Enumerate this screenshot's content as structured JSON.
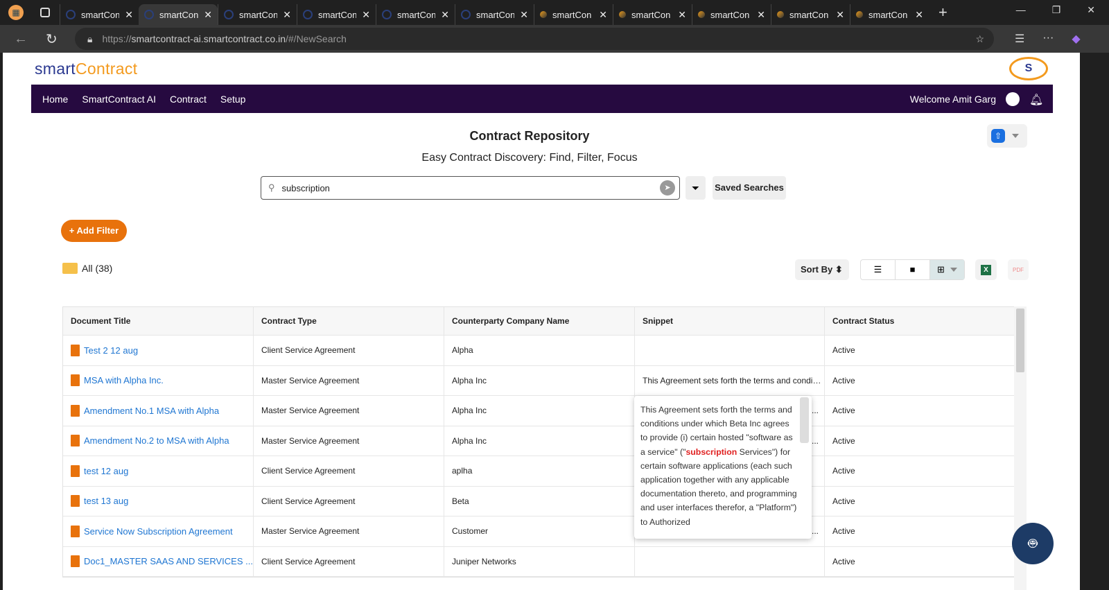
{
  "browser": {
    "tabs": [
      {
        "label": "smartCon"
      },
      {
        "label": "smartCon",
        "active": true
      },
      {
        "label": "smartCon"
      },
      {
        "label": "smartCon"
      },
      {
        "label": "smartCon"
      },
      {
        "label": "smartCon"
      },
      {
        "label": "smartCon"
      },
      {
        "label": "smartCon"
      },
      {
        "label": "smartCon"
      },
      {
        "label": "smartCon"
      },
      {
        "label": "smartCon"
      }
    ],
    "url_prefix": "https://",
    "url_host": "smartcontract-ai.smartcontract.co.in",
    "url_path": "/#/NewSearch"
  },
  "header": {
    "logo_a": "smart",
    "logo_b": "Contract",
    "nav": [
      "Home",
      "SmartContract AI",
      "Contract",
      "Setup"
    ],
    "welcome": "Welcome Amit Garg"
  },
  "main": {
    "title": "Contract Repository",
    "subtitle": "Easy Contract Discovery: Find, Filter, Focus",
    "search_value": "subscription",
    "saved_searches": "Saved Searches",
    "add_filter": "+ Add Filter",
    "all_label": "All (38)",
    "sort_by": "Sort By"
  },
  "table": {
    "columns": [
      "Document Title",
      "Contract Type",
      "Counterparty Company Name",
      "Snippet",
      "Contract Status"
    ],
    "rows": [
      [
        "Test 2 12 aug",
        "Client Service Agreement",
        "Alpha",
        "",
        "Active"
      ],
      [
        "MSA with Alpha Inc.",
        "Master Service Agreement",
        "Alpha Inc",
        "This Agreement sets forth the terms and conditions under which Beta Inc",
        "Active"
      ],
      [
        "Amendment No.1 MSA with Alpha",
        "Master Service Agreement",
        "Alpha Inc",
        "...",
        "Active"
      ],
      [
        "Amendment No.2 to MSA with Alpha",
        "Master Service Agreement",
        "Alpha Inc",
        "...",
        "Active"
      ],
      [
        "test 12 aug",
        "Client Service Agreement",
        "aplha",
        "",
        "Active"
      ],
      [
        "test 13 aug",
        "Client Service Agreement",
        "Beta",
        "",
        "Active"
      ],
      [
        "Service Now Subscription Agreement",
        "Master Service Agreement",
        "Customer",
        "...",
        "Active"
      ],
      [
        "Doc1_MASTER SAAS AND SERVICES ...",
        "Client Service Agreement",
        "Juniper Networks",
        "",
        "Active"
      ]
    ]
  },
  "tooltip": {
    "before": "This Agreement sets forth the terms and conditions under which Beta Inc agrees to provide (i) certain hosted \"software as a service\" (\"",
    "highlight": "subscription",
    "after": " Services\") for certain software applications (each such application together with any applicable documentation thereto, and programming and user interfaces therefor, a \"Platform\") to Authorized"
  },
  "colors": {
    "nav_bg": "#260a40",
    "accent": "#e8720c",
    "link": "#1f76d2",
    "highlight": "#e02020"
  }
}
